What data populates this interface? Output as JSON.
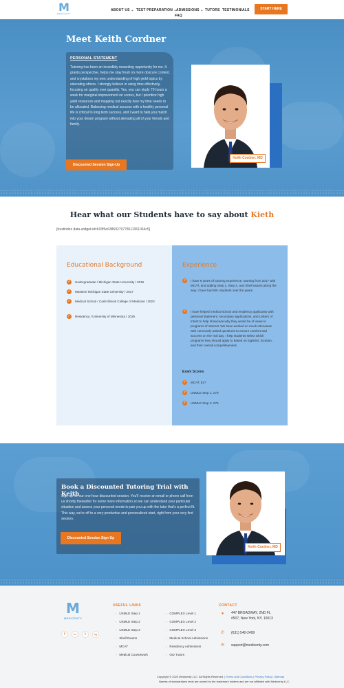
{
  "nav": {
    "logo_letter": "M",
    "logo_text": "MEDICENTY",
    "items": [
      "ABOUT US ⌄",
      "TEST PREPARATION ⌄",
      "ADMISSIONS ⌄",
      "TUTORS",
      "TESTIMONIALS",
      "FAQ"
    ],
    "cta": "START HERE"
  },
  "hero": {
    "title": "Meet Keith Cordner",
    "statement_heading": "PERSONAL STATEMENT",
    "statement": "Tutoring has been an incredibly rewarding opportunity for me. It grants perspective, helps me stay fresh on more obscure content, and crystalizes my own understanding of high yield topics by educating others. I strongly believe in using time effectively, focusing on quality over quantity. Yes, you can study 70 hours a week for marginal improvement on scores, but I prioritize high yield resources and mapping out exactly how my time needs to be allocated. Balancing medical success with a healthy personal life is critical to long term success, and I want to help you match into your dream program without alienating all of your friends and family.",
    "button": "Discounted Session Sign-Up",
    "photo_name": "Keith Cordner, MD"
  },
  "testimonials": {
    "title_prefix": "Hear what our Students have to say about ",
    "title_name": "Kieth",
    "widget_code": "[trustindex data-widget-id=693f5e63869279778611061064c5]"
  },
  "education": {
    "heading": "Educational Background",
    "items": [
      "Undergraduate / Michigan State University / 2015",
      "Masters/ Michigan State University / 2017",
      "Medical School / Carle Illinois College of Medicine / 2023",
      "Residency / University of Minnesota / 2026"
    ]
  },
  "experience": {
    "heading": "Experience",
    "items": [
      "I have 6 years of tutoring experience, starting from 2017 with MCAT, and adding Step 1, Step 2, and Shelf exams along the way. I have had 60+ students over the years.",
      "I have helped medical school and residency applicants with personal statement, secondary applications, and Letters of Intent to help showcase why they would be of value to programs of interest. We have worked on mock interviews with commonly asked questions to ensure comfort and success on the real day. I help students select which programs they should apply to based on logistics, location, and their overall competitiveness."
    ],
    "exam_heading": "Exam Scores",
    "scores": [
      "MCAT: 517",
      "USMLE Step 1: 270",
      "USMLE Step 2: 275"
    ]
  },
  "book": {
    "title": "Book a Discounted Tutoring Trial with Keith",
    "text": "Sign up for our one-hour discounted session. You'll receive an email or phone call from us shortly thereafter for some more information so we can understand your particular situation and assess your personal needs to pair you up with the tutor that's a perfect fit. This way, we're off to a very productive and personalized start, right from your very first session.",
    "button": "Discounted Session Sign-Up",
    "photo_name": "Keith Cordner, MD"
  },
  "footer": {
    "logo_letter": "M",
    "logo_text": "MEDICENTY",
    "social": [
      "f",
      "in",
      "t",
      "ig"
    ],
    "useful_links_heading": "USEFUL LINKS",
    "links_col1": [
      "USMLE Step 1",
      "USMLE Step 2",
      "USMLE Step 3",
      "Shelf Exams",
      "MCAT",
      "Medical Coursework"
    ],
    "links_col2": [
      "COMPLEX Level 1",
      "COMPLEX Level 2",
      "COMPLEX Level 3",
      "Medical School Admissions",
      "Residency Admissions",
      "Our Tutors"
    ],
    "contact_heading": "CONTACT",
    "address_line1": "447 BROADWAY, 2ND FL",
    "address_line2": "#507, New York, NY, 10013",
    "phone": "(631) 540-2499",
    "email": "support@medicenty.com",
    "copyright": "Copyright © 2024 Medicenty LLC. All Rights Reserved. | ",
    "copyright_links": "Terms and Conditions | Privacy Policy | Sitemap",
    "disclaimer": "Names of standardized tests are owned by the trademark holders and are not affiliated with Medicenty LLC."
  },
  "colors": {
    "accent": "#e87722",
    "hero_blue": "#4a8fc4",
    "panel_blue": "#8cbcea",
    "panel_light": "#e9f2fb"
  }
}
